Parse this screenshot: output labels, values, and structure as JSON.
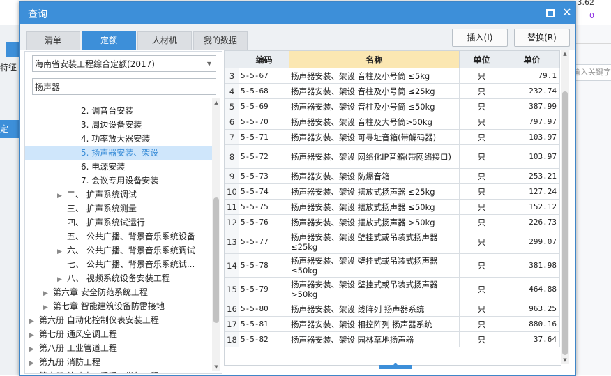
{
  "background": {
    "num_top": "3.62",
    "num_purple": "0",
    "left_label": "特征",
    "left_selected": "定",
    "right_search_placeholder": "输入关键字"
  },
  "dialog": {
    "title": "查询",
    "tabs": [
      "清单",
      "定额",
      "人材机",
      "我的数据"
    ],
    "active_tab": "定额",
    "insert_label": "插入(I)",
    "replace_label": "替换(R)"
  },
  "left": {
    "quota_library": "海南省安装工程综合定额(2017)",
    "search_value": "扬声器",
    "tree": [
      {
        "label": "2. 调音台安装",
        "arrow": ""
      },
      {
        "label": "3. 周边设备安装",
        "arrow": ""
      },
      {
        "label": "4. 功率放大器安装",
        "arrow": ""
      },
      {
        "label": "5. 扬声器安装、架设",
        "arrow": "",
        "selected": true
      },
      {
        "label": "6. 电源安装",
        "arrow": ""
      },
      {
        "label": "7. 会议专用设备安装",
        "arrow": ""
      },
      {
        "label": "二、 扩声系统调试",
        "arrow": "▶"
      },
      {
        "label": "三、 扩声系统测量",
        "arrow": ""
      },
      {
        "label": "四、 扩声系统试运行",
        "arrow": ""
      },
      {
        "label": "五、 公共广播、背景音乐系统设备",
        "arrow": ""
      },
      {
        "label": "六、 公共广播、背景音乐系统调试",
        "arrow": "▶"
      },
      {
        "label": "七、 公共广播、背景音乐系统试...",
        "arrow": ""
      },
      {
        "label": "八、 视频系统设备安装工程",
        "arrow": "▶"
      },
      {
        "label": "第六章 安全防范系统工程",
        "arrow": "▶"
      },
      {
        "label": "第七章 智能建筑设备防雷接地",
        "arrow": "▶"
      },
      {
        "label": "第六册 自动化控制仪表安装工程",
        "arrow": "▶"
      },
      {
        "label": "第七册 通风空调工程",
        "arrow": "▶"
      },
      {
        "label": "第八册 工业管道工程",
        "arrow": "▶"
      },
      {
        "label": "第九册 消防工程",
        "arrow": "▶"
      },
      {
        "label": "第十册 给排水、采暖、燃气工程",
        "arrow": "▶"
      }
    ]
  },
  "table": {
    "headers": {
      "code": "编码",
      "name": "名称",
      "unit": "单位",
      "price": "单价"
    },
    "rows": [
      {
        "idx": "3",
        "code": "5-5-67",
        "name": "扬声器安装、架设 音柱及小号筒 ≤5kg",
        "unit": "只",
        "price": "79.1"
      },
      {
        "idx": "4",
        "code": "5-5-68",
        "name": "扬声器安装、架设 音柱及小号筒 ≤25kg",
        "unit": "只",
        "price": "232.74"
      },
      {
        "idx": "5",
        "code": "5-5-69",
        "name": "扬声器安装、架设 音柱及小号筒 ≤50kg",
        "unit": "只",
        "price": "387.99"
      },
      {
        "idx": "6",
        "code": "5-5-70",
        "name": "扬声器安装、架设 音柱及大号筒>50kg",
        "unit": "只",
        "price": "797.97"
      },
      {
        "idx": "7",
        "code": "5-5-71",
        "name": "扬声器安装、架设 可寻址音箱(带解码器)",
        "unit": "只",
        "price": "103.97"
      },
      {
        "idx": "8",
        "code": "5-5-72",
        "name": "扬声器安装、架设 网络化IP音箱(带网络接口)",
        "unit": "只",
        "price": "103.97"
      },
      {
        "idx": "9",
        "code": "5-5-73",
        "name": "扬声器安装、架设 防爆音箱",
        "unit": "只",
        "price": "253.21"
      },
      {
        "idx": "10",
        "code": "5-5-74",
        "name": "扬声器安装、架设 摆放式扬声器 ≤25kg",
        "unit": "只",
        "price": "127.24"
      },
      {
        "idx": "11",
        "code": "5-5-75",
        "name": "扬声器安装、架设 摆放式扬声器 ≤50kg",
        "unit": "只",
        "price": "152.12"
      },
      {
        "idx": "12",
        "code": "5-5-76",
        "name": "扬声器安装、架设 摆放式扬声器 >50kg",
        "unit": "只",
        "price": "226.73"
      },
      {
        "idx": "13",
        "code": "5-5-77",
        "name": "扬声器安装、架设 壁挂式或吊装式扬声器≤25kg",
        "unit": "只",
        "price": "299.07"
      },
      {
        "idx": "14",
        "code": "5-5-78",
        "name": "扬声器安装、架设 壁挂式或吊装式扬声器≤50kg",
        "unit": "只",
        "price": "381.98"
      },
      {
        "idx": "15",
        "code": "5-5-79",
        "name": "扬声器安装、架设 壁挂式或吊装式扬声器>50kg",
        "unit": "只",
        "price": "464.88"
      },
      {
        "idx": "16",
        "code": "5-5-80",
        "name": "扬声器安装、架设 线阵列 扬声器系统",
        "unit": "只",
        "price": "963.25"
      },
      {
        "idx": "17",
        "code": "5-5-81",
        "name": "扬声器安装、架设 相控阵列 扬声器系统",
        "unit": "只",
        "price": "880.16"
      },
      {
        "idx": "18",
        "code": "5-5-82",
        "name": "扬声器安装、架设 园林草地扬声器",
        "unit": "只",
        "price": "37.64"
      }
    ]
  },
  "colors": {
    "accent": "#3d8fd9",
    "header_highlight": "#fbe7b2",
    "selection": "#cfe6fb"
  }
}
